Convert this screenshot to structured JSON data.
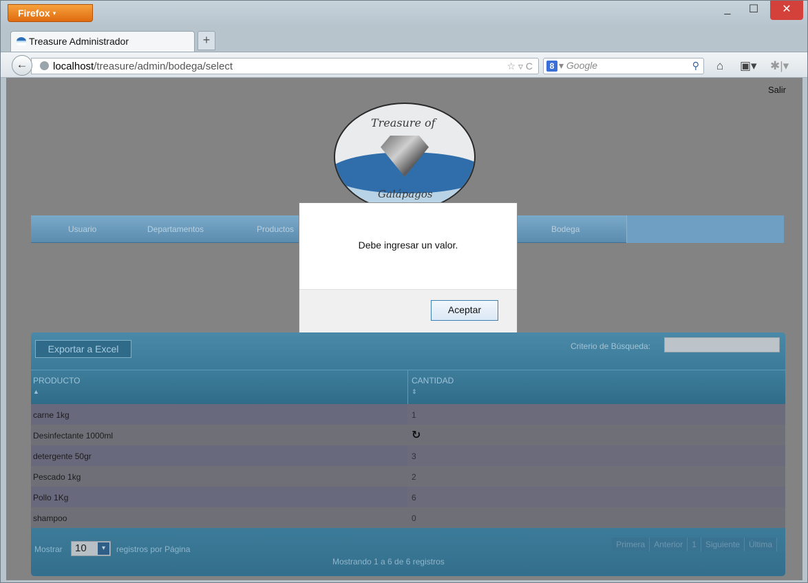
{
  "browser": {
    "menu_button": "Firefox",
    "menu_caret": "▾",
    "window_controls": {
      "minimize": "_",
      "maximize": "☐",
      "close": "✕"
    },
    "tab_title": "Treasure Administrador",
    "new_tab": "+",
    "back": "←",
    "url_host": "localhost",
    "url_path": "/treasure/admin/bodega/select",
    "url_actions": "☆ ▿ C",
    "search_engine_icon": "8",
    "search_placeholder": "▾ Google",
    "search_icon": "⚲",
    "home_icon": "⌂",
    "bookmarks_icon": "▣▾",
    "extension_icon": "✱|▾"
  },
  "page": {
    "logout": "Salir",
    "logo_text_top": "Treasure of",
    "logo_text_bottom": "Galápagos",
    "menu": [
      "Usuario",
      "Departamentos",
      "Productos",
      "Bodega"
    ]
  },
  "table": {
    "export_button": "Exportar a Excel",
    "search_label": "Criterio de Búsqueda:",
    "search_value": "",
    "columns": [
      "PRODUCTO",
      "CANTIDAD"
    ],
    "sort_icons": [
      "▲",
      "⇕"
    ],
    "rows": [
      {
        "producto": "carne 1kg",
        "cantidad": "1"
      },
      {
        "producto": "Desinfectante 1000ml",
        "cantidad": "↻"
      },
      {
        "producto": "detergente 50gr",
        "cantidad": "3"
      },
      {
        "producto": "Pescado 1kg",
        "cantidad": "2"
      },
      {
        "producto": "Pollo 1Kg",
        "cantidad": "6"
      },
      {
        "producto": "shampoo",
        "cantidad": "0"
      }
    ],
    "show_label": "Mostrar",
    "page_size": "10",
    "page_size_arrow": "▾",
    "per_page_label": "registros por Página",
    "status": "Mostrando 1 a 6 de 6 registros",
    "pager": [
      "Primera",
      "Anterior",
      "1",
      "Siguiente",
      "Última"
    ]
  },
  "dialog": {
    "message": "Debe ingresar un valor.",
    "ok_button": "Aceptar"
  }
}
